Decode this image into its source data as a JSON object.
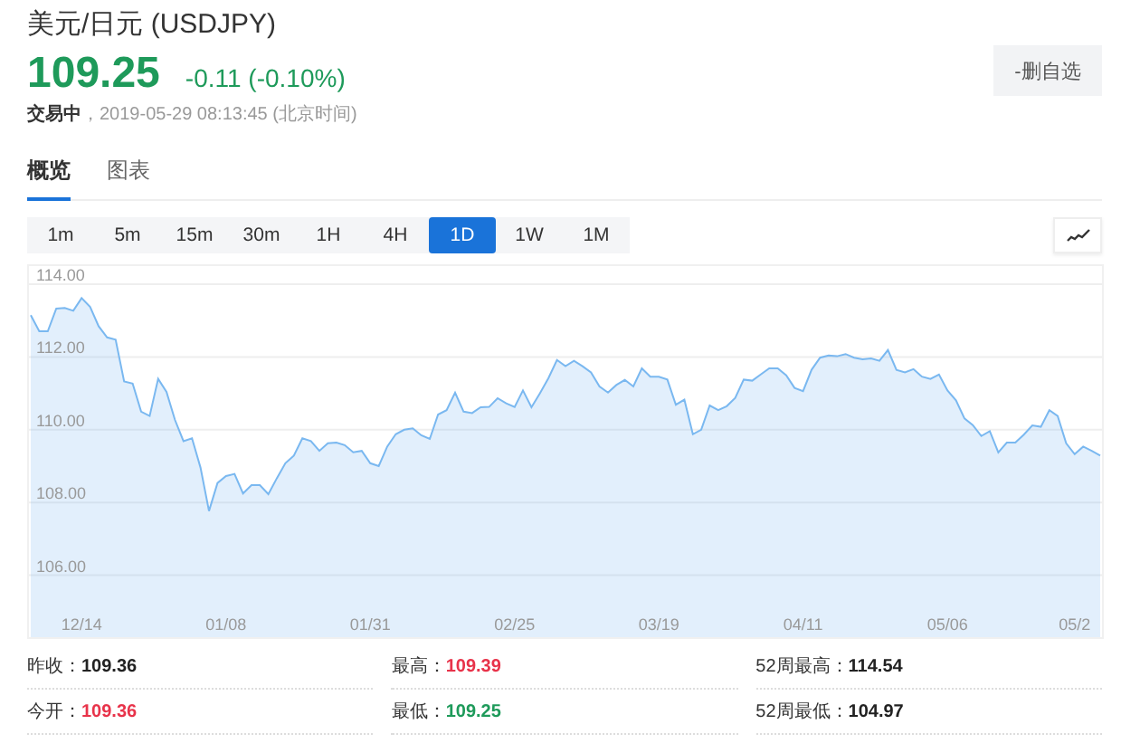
{
  "header": {
    "title": "美元/日元 (USDJPY)",
    "price": "109.25",
    "change": "-0.11 (-0.10%)",
    "status": "**交易中**，2019-05-29 08:13:45  (北京时间)",
    "button": "-删自选"
  },
  "tabs": [
    {
      "label": "概览",
      "selected": true
    },
    {
      "label": "图表",
      "selected": false
    }
  ],
  "periods": [
    {
      "label": "1m",
      "selected": false
    },
    {
      "label": "5m",
      "selected": false
    },
    {
      "label": "15m",
      "selected": false
    },
    {
      "label": "30m",
      "selected": false
    },
    {
      "label": "1H",
      "selected": false
    },
    {
      "label": "4H",
      "selected": false
    },
    {
      "label": "1D",
      "selected": true
    },
    {
      "label": "1W",
      "selected": false
    },
    {
      "label": "1M",
      "selected": false
    }
  ],
  "chart_data": {
    "type": "area",
    "grid": true,
    "ylim": [
      104.3,
      114.5
    ],
    "categories": [
      null,
      null,
      null,
      null,
      null,
      null,
      "12/14",
      null,
      null,
      null,
      null,
      null,
      null,
      null,
      null,
      null,
      null,
      null,
      null,
      null,
      null,
      null,
      null,
      "01/08",
      null,
      null,
      null,
      null,
      null,
      null,
      null,
      null,
      null,
      null,
      null,
      null,
      null,
      null,
      null,
      null,
      "01/31",
      null,
      null,
      null,
      null,
      null,
      null,
      null,
      null,
      null,
      null,
      null,
      null,
      null,
      null,
      null,
      null,
      "02/25",
      null,
      null,
      null,
      null,
      null,
      null,
      null,
      null,
      null,
      null,
      null,
      null,
      null,
      null,
      null,
      null,
      "03/19",
      null,
      null,
      null,
      null,
      null,
      null,
      null,
      null,
      null,
      null,
      null,
      null,
      null,
      null,
      null,
      null,
      "04/11",
      null,
      null,
      null,
      null,
      null,
      null,
      null,
      null,
      null,
      null,
      null,
      null,
      null,
      null,
      null,
      null,
      "05/06",
      null,
      null,
      null,
      null,
      null,
      null,
      null,
      null,
      null,
      null,
      null,
      null,
      null,
      null,
      "05/2",
      null,
      null,
      null
    ],
    "yticks": [
      {
        "value": 106,
        "label": "106.00"
      },
      {
        "value": 108,
        "label": "108.00"
      },
      {
        "value": 110,
        "label": "110.00"
      },
      {
        "value": 112,
        "label": "112.00"
      },
      {
        "value": 114,
        "label": "114.00"
      }
    ],
    "series": [
      {
        "color": "#7ab8f0",
        "values": [
          113.15,
          112.71,
          112.71,
          113.33,
          113.35,
          113.27,
          113.62,
          113.38,
          112.85,
          112.54,
          112.48,
          111.33,
          111.27,
          110.5,
          110.38,
          111.4,
          111.04,
          110.27,
          109.69,
          109.77,
          108.96,
          107.77,
          108.54,
          108.73,
          108.79,
          108.25,
          108.48,
          108.48,
          108.23,
          108.67,
          109.08,
          109.29,
          109.77,
          109.69,
          109.42,
          109.63,
          109.65,
          109.58,
          109.38,
          109.42,
          109.08,
          109.0,
          109.54,
          109.88,
          110.0,
          110.04,
          109.85,
          109.75,
          110.42,
          110.54,
          111.02,
          110.5,
          110.46,
          110.62,
          110.63,
          110.87,
          110.73,
          110.63,
          111.08,
          110.62,
          111.0,
          111.42,
          111.92,
          111.75,
          111.9,
          111.75,
          111.58,
          111.19,
          111.02,
          111.23,
          111.37,
          111.19,
          111.69,
          111.46,
          111.46,
          111.38,
          110.69,
          110.83,
          109.88,
          110.0,
          110.67,
          110.54,
          110.65,
          110.88,
          111.38,
          111.35,
          111.52,
          111.69,
          111.69,
          111.5,
          111.15,
          111.06,
          111.65,
          111.98,
          112.04,
          112.02,
          112.08,
          111.98,
          111.94,
          111.96,
          111.9,
          112.19,
          111.65,
          111.58,
          111.67,
          111.46,
          111.4,
          111.52,
          111.08,
          110.81,
          110.31,
          110.13,
          109.83,
          109.96,
          109.38,
          109.65,
          109.65,
          109.87,
          110.12,
          110.08,
          110.54,
          110.38,
          109.63,
          109.33,
          109.54,
          109.42,
          109.29
        ]
      }
    ]
  },
  "stats": [
    {
      "label": "昨收：",
      "value": "109.36",
      "color": "#222222"
    },
    {
      "label": "最高：",
      "value": "109.39",
      "color": "#e8334a"
    },
    {
      "label": "52周最高：",
      "value": "114.54",
      "color": "#222222"
    },
    {
      "label": "今开：",
      "value": "109.36",
      "color": "#e8334a"
    },
    {
      "label": "最低：",
      "value": "109.25",
      "color": "#1e9a5a"
    },
    {
      "label": "52周最低：",
      "value": "104.97",
      "color": "#222222"
    }
  ]
}
